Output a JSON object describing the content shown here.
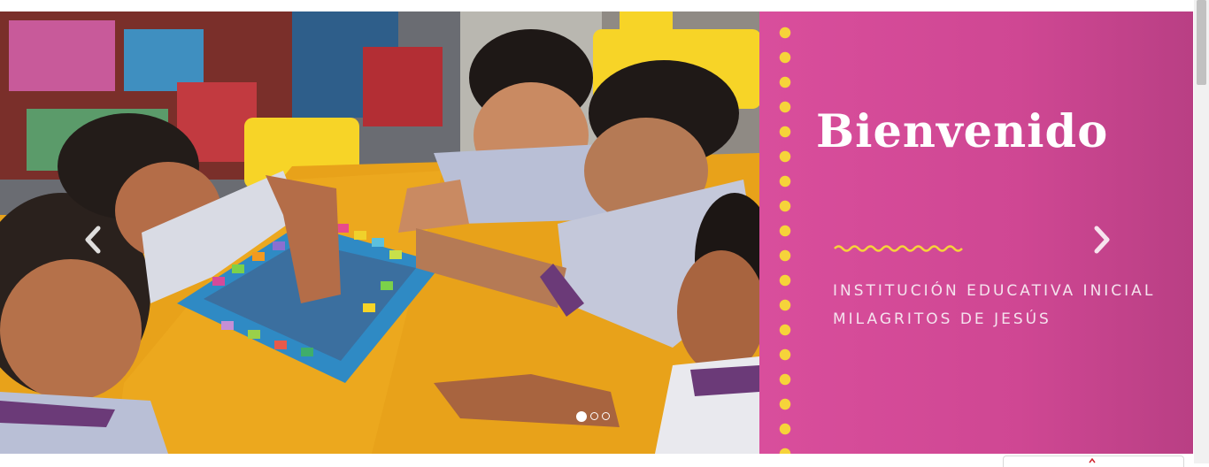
{
  "carousel": {
    "slide": {
      "heading": "Bienvenido",
      "subtitle_line1": "INSTITUCIÓN EDUCATIVA INICIAL",
      "subtitle_line2": "MILAGRITOS DE JESÚS"
    },
    "controls": {
      "prev_icon": "chevron-left-icon",
      "next_icon": "chevron-right-icon"
    },
    "indicators": {
      "count": 3,
      "active_index": 0
    }
  },
  "colors": {
    "panel_pink": "#d94e9c",
    "dot_yellow": "#f6d33a",
    "table_orange": "#e8a21a",
    "chair_yellow": "#f7d427",
    "uniform_lavender": "#b9bfd6",
    "uniform_purple": "#6b3a78"
  }
}
